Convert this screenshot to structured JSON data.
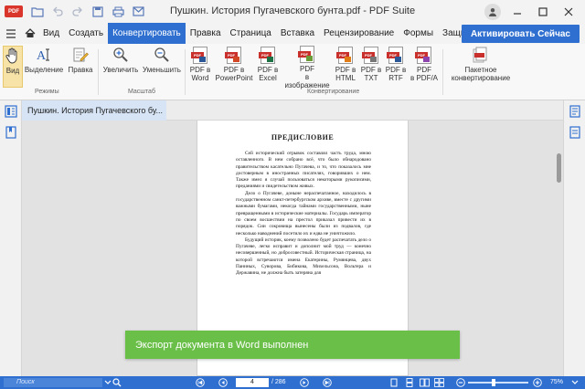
{
  "app": {
    "logo_text": "PDF",
    "title": "Пушкин. История Пугачевского бунта.pdf - PDF Suite"
  },
  "menu": {
    "tabs": [
      {
        "label": "Вид"
      },
      {
        "label": "Создать"
      },
      {
        "label": "Конвертировать",
        "active": true
      },
      {
        "label": "Правка"
      },
      {
        "label": "Страница"
      },
      {
        "label": "Вставка"
      },
      {
        "label": "Рецензирование"
      },
      {
        "label": "Формы"
      },
      {
        "label": "Защита и По"
      }
    ],
    "activate_label": "Активировать Сейчас"
  },
  "ribbon": {
    "modes": {
      "group_label": "Режимы",
      "view": "Вид",
      "select": "Выделение",
      "edit": "Правка"
    },
    "scale": {
      "group_label": "Масштаб",
      "zoom_in": "Увеличить",
      "zoom_out": "Уменьшить"
    },
    "convert": {
      "group_label": "Конвертирование",
      "word": [
        "PDF в",
        "Word"
      ],
      "powerpoint": [
        "PDF в",
        "PowerPoint"
      ],
      "excel": [
        "PDF в",
        "Excel"
      ],
      "image": [
        "PDF",
        "в изображение"
      ],
      "html": [
        "PDF в",
        "HTML"
      ],
      "txt": [
        "PDF в",
        "TXT"
      ],
      "rtf": [
        "PDF в",
        "RTF"
      ],
      "pdfa": [
        "PDF",
        "в PDF/A"
      ],
      "batch": [
        "Пакетное",
        "конвертирование"
      ]
    },
    "icon_badges": {
      "word": "PDF",
      "powerpoint": "PDF",
      "excel": "PDF",
      "image": "PDF",
      "html": "PDF",
      "txt": "PDF",
      "rtf": "PDF",
      "pdfa": "PDF"
    }
  },
  "document": {
    "tab_label": "Пушкин. История Пугачевского бу...",
    "heading": "ПРЕДИСЛОВИЕ",
    "paragraphs": [
      "Сей исторический отрывок составлял часть труда, мною оставленного. В нем собрано всё, что было обнародовано правительством касательно Пугачева, и то, что показалось мне достоверным в иностранных писателях, говоривших о нем. Также имел я случай пользоваться некоторыми рукописями, преданиями и свидетельством живых.",
      "Дело о Пугачеве, доныне нераспечатанное, находилось в государственном санкт-петербургском архиве, вместе с другими важными бумагами, некогда тайнами государственными, ныне превращенными в исторические материалы. Государь император по своем восшествии на престол приказал привести их в порядок. Сии сокровища вынесены были из подвалов, где несколько наводнений посетило их и едва не уничтожило.",
      "Будущий историк, коему позволено будет распечатать дело о Пугачеве, легко исправит и дополнит мой труд — конечно несовершенный, но добросовестный. Историческая страница, на которой встречаются имена Екатерины, Румянцева, двух Паниных, Суворова, Бибикова, Михельсона, Вольтера и Державина, не должна быть затеряна для"
    ]
  },
  "toast": {
    "message": "Экспорт документа в Word выполнен"
  },
  "statusbar": {
    "search_placeholder": "Поиск",
    "current_page": "4",
    "total_pages": "/ 286",
    "zoom": "75%",
    "zoom_fraction": 0.42
  },
  "colors": {
    "accent": "#2f6fd0",
    "toast": "#6abf49",
    "pdf_red": "#c9302c"
  }
}
